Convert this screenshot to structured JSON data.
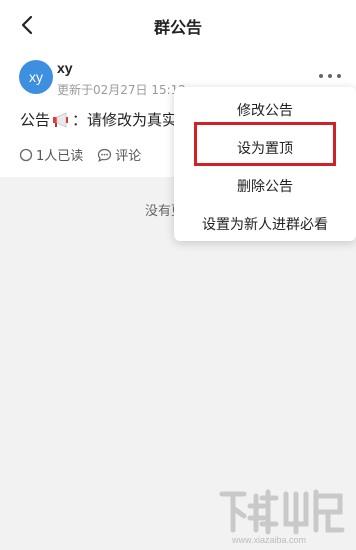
{
  "header": {
    "title": "群公告",
    "back_icon": "chevron-left-icon"
  },
  "post": {
    "avatar_text": "xy",
    "author": "xy",
    "updated": "更新于02月27日 15:12",
    "content_prefix": "公告",
    "content_icon": "megaphone-icon",
    "content_text": "：请修改为真实",
    "read_count": "1人已读",
    "comment_label": "评论",
    "more_icon": "more-dots-icon"
  },
  "empty_text": "没有更",
  "menu": {
    "items": [
      {
        "label": "修改公告"
      },
      {
        "label": "设为置顶"
      },
      {
        "label": "删除公告"
      },
      {
        "label": "设置为新人进群必看"
      }
    ],
    "highlight_color": "#d0202a"
  },
  "watermark": {
    "url": "www.xiazaiba.com"
  }
}
